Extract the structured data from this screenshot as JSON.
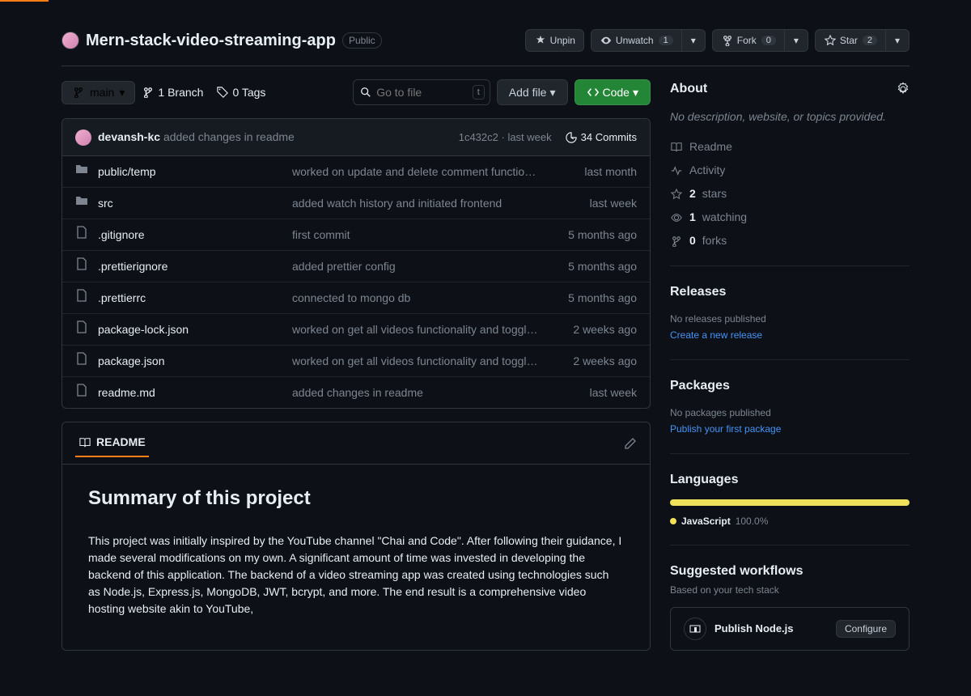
{
  "repo": {
    "name": "Mern-stack-video-streaming-app",
    "visibility": "Public"
  },
  "actions": {
    "unpin": "Unpin",
    "unwatch": "Unwatch",
    "watch_count": "1",
    "fork": "Fork",
    "fork_count": "0",
    "star": "Star",
    "star_count": "2"
  },
  "nav": {
    "branch": "main",
    "branches": "1 Branch",
    "tags": "0 Tags",
    "gotofile_placeholder": "Go to file",
    "gotofile_key": "t",
    "addfile": "Add file",
    "code": "Code"
  },
  "commit": {
    "author": "devansh-kc",
    "message": "added changes in readme",
    "hash": "1c432c2",
    "when": "last week",
    "count": "34 Commits"
  },
  "files": [
    {
      "type": "dir",
      "name": "public/temp",
      "msg": "worked on update and delete comment functionality",
      "time": "last month"
    },
    {
      "type": "dir",
      "name": "src",
      "msg": "added watch history and initiated frontend",
      "time": "last week"
    },
    {
      "type": "file",
      "name": ".gitignore",
      "msg": "first commit",
      "time": "5 months ago"
    },
    {
      "type": "file",
      "name": ".prettierignore",
      "msg": "added prettier config",
      "time": "5 months ago"
    },
    {
      "type": "file",
      "name": ".prettierrc",
      "msg": "connected to mongo db",
      "time": "5 months ago"
    },
    {
      "type": "file",
      "name": "package-lock.json",
      "msg": "worked on get all videos functionality and toggle subscriptio...",
      "time": "2 weeks ago"
    },
    {
      "type": "file",
      "name": "package.json",
      "msg": "worked on get all videos functionality and toggle subscriptio...",
      "time": "2 weeks ago"
    },
    {
      "type": "file",
      "name": "readme.md",
      "msg": "added changes in readme",
      "time": "last week"
    }
  ],
  "readme": {
    "tab": "README",
    "heading": "Summary of this project",
    "body": "This project was initially inspired by the YouTube channel \"Chai and Code\". After following their guidance, I made several modifications on my own. A significant amount of time was invested in developing the backend of this application. The backend of a video streaming app was created using technologies such as Node.js, Express.js, MongoDB, JWT, bcrypt, and more. The end result is a comprehensive video hosting website akin to YouTube,"
  },
  "about": {
    "title": "About",
    "desc": "No description, website, or topics provided.",
    "readme": "Readme",
    "activity": "Activity",
    "stars_n": "2",
    "stars_t": "stars",
    "watching_n": "1",
    "watching_t": "watching",
    "forks_n": "0",
    "forks_t": "forks"
  },
  "releases": {
    "title": "Releases",
    "none": "No releases published",
    "create": "Create a new release"
  },
  "packages": {
    "title": "Packages",
    "none": "No packages published",
    "publish": "Publish your first package"
  },
  "languages": {
    "title": "Languages",
    "lang": "JavaScript",
    "pct": "100.0%"
  },
  "workflows": {
    "title": "Suggested workflows",
    "subtitle": "Based on your tech stack",
    "item": "Publish Node.js",
    "configure": "Configure"
  }
}
